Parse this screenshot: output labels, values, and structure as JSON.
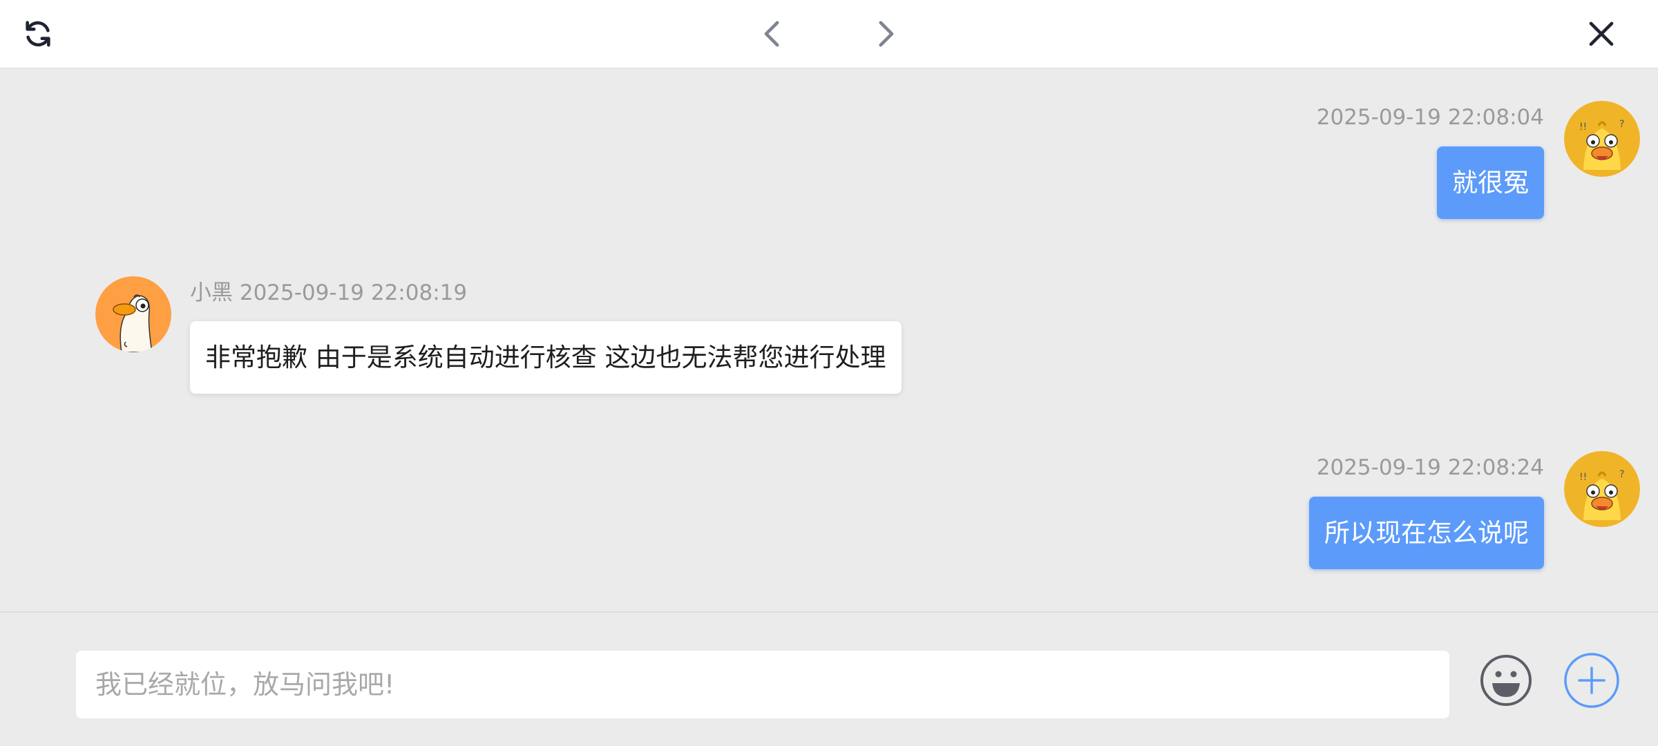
{
  "toolbar": {
    "icons": {
      "refresh": "refresh-icon",
      "back": "chevron-left-icon",
      "forward": "chevron-right-icon",
      "close": "close-icon"
    }
  },
  "messages": [
    {
      "side": "right",
      "sender": "",
      "timestamp": "2025-09-19 22:08:04",
      "text": "就很冤"
    },
    {
      "side": "left",
      "sender": "小黑",
      "timestamp": "2025-09-19 22:08:19",
      "meta_line": "小黑 2025-09-19 22:08:19",
      "text": "非常抱歉 由于是系统自动进行核查 这边也无法帮您进行处理"
    },
    {
      "side": "right",
      "sender": "",
      "timestamp": "2025-09-19 22:08:24",
      "text": "所以现在怎么说呢"
    }
  ],
  "composer": {
    "placeholder": "我已经就位，放马问我吧!",
    "value": "",
    "icons": {
      "emoji": "emoji-icon",
      "plus": "plus-icon"
    }
  },
  "colors": {
    "background": "#ebebeb",
    "my_bubble": "#5c9bfa",
    "their_bubble": "#ffffff",
    "accent": "#5c9bfa",
    "user_avatar_bg": "#f0b429",
    "agent_avatar_bg": "#ff9f43"
  }
}
